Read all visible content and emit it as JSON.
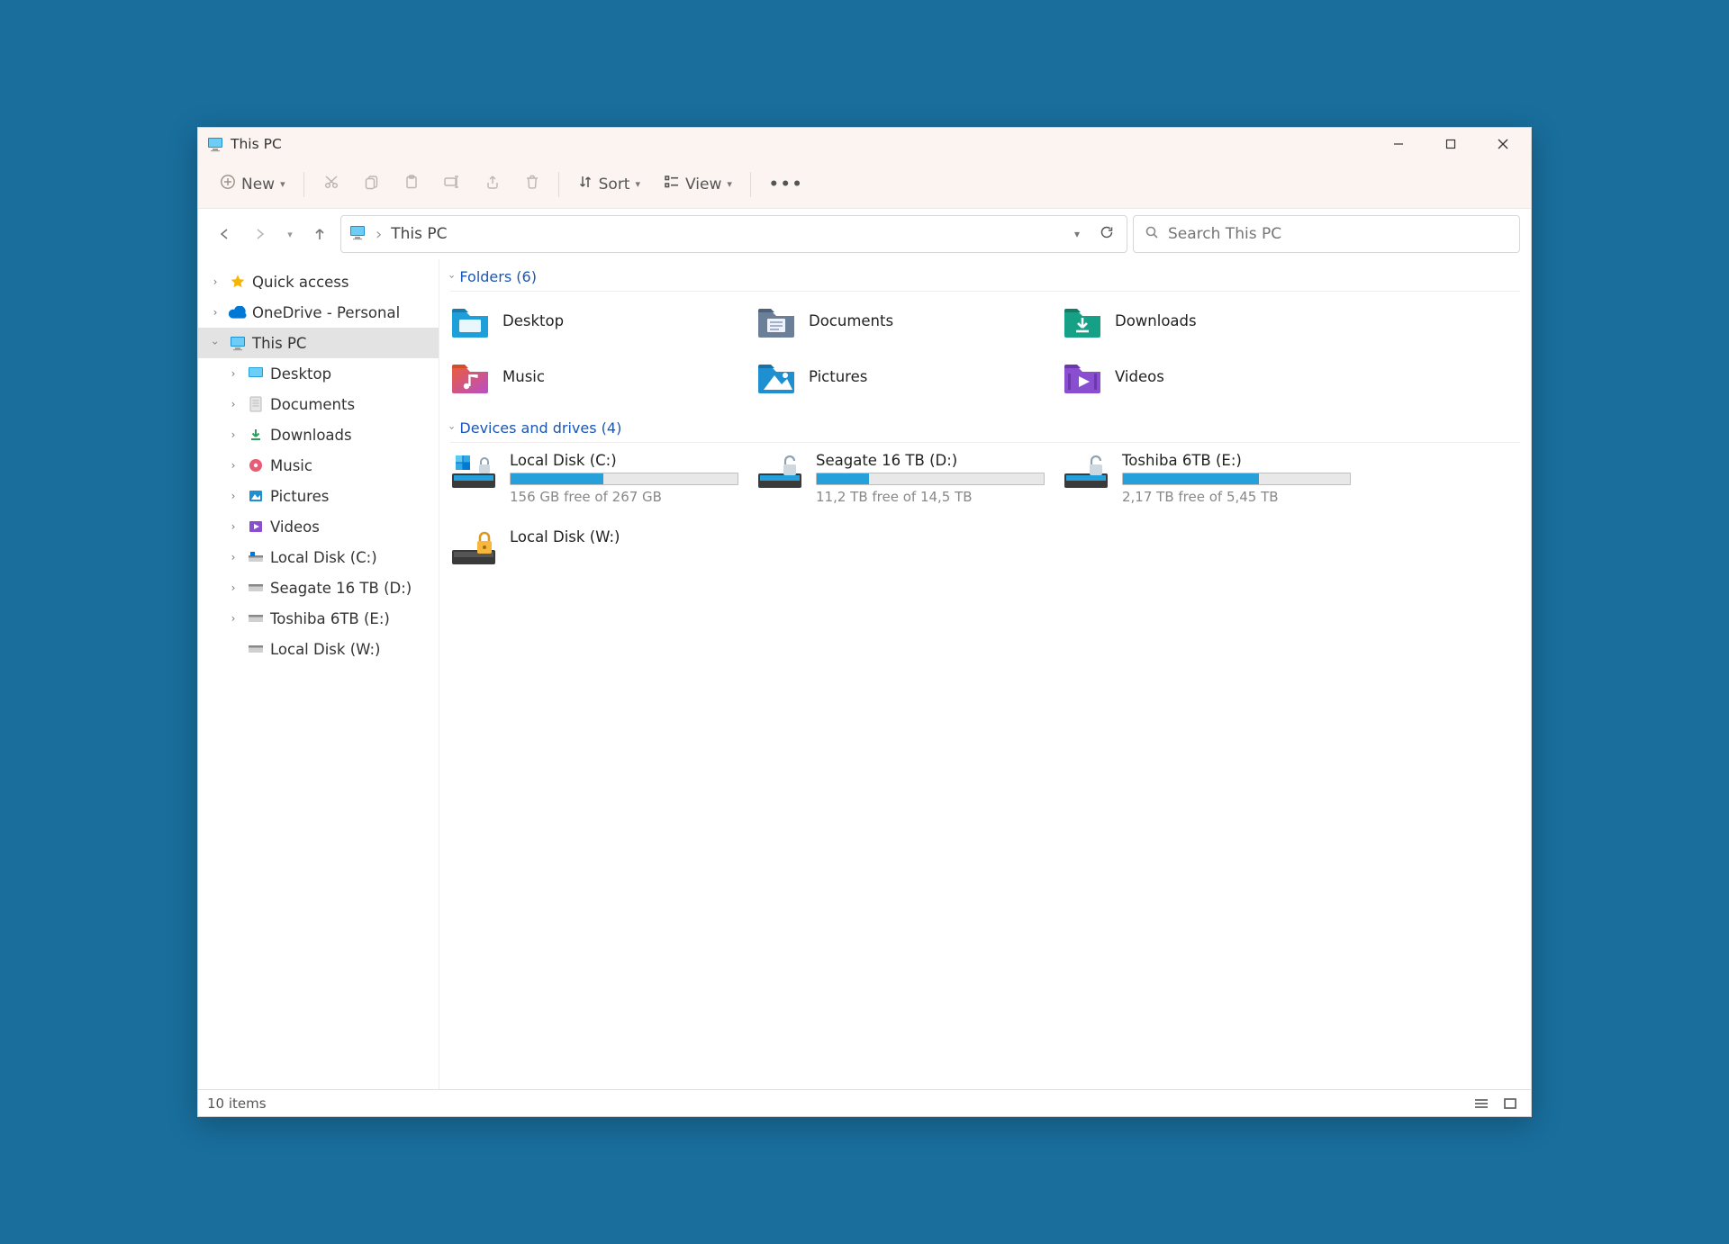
{
  "window": {
    "title": "This PC"
  },
  "toolbar": {
    "new_label": "New",
    "sort_label": "Sort",
    "view_label": "View"
  },
  "address": {
    "location": "This PC"
  },
  "search": {
    "placeholder": "Search This PC"
  },
  "sidebar": {
    "quick_access": "Quick access",
    "onedrive": "OneDrive - Personal",
    "this_pc": "This PC",
    "children": [
      {
        "label": "Desktop"
      },
      {
        "label": "Documents"
      },
      {
        "label": "Downloads"
      },
      {
        "label": "Music"
      },
      {
        "label": "Pictures"
      },
      {
        "label": "Videos"
      },
      {
        "label": "Local Disk (C:)"
      },
      {
        "label": "Seagate 16 TB (D:)"
      },
      {
        "label": "Toshiba 6TB (E:)"
      },
      {
        "label": "Local Disk (W:)"
      }
    ]
  },
  "groups": {
    "folders": {
      "header": "Folders (6)",
      "items": [
        {
          "label": "Desktop"
        },
        {
          "label": "Documents"
        },
        {
          "label": "Downloads"
        },
        {
          "label": "Music"
        },
        {
          "label": "Pictures"
        },
        {
          "label": "Videos"
        }
      ]
    },
    "drives": {
      "header": "Devices and drives (4)",
      "items": [
        {
          "label": "Local Disk (C:)",
          "free_text": "156 GB free of 267 GB",
          "fill_pct": 41
        },
        {
          "label": "Seagate 16 TB (D:)",
          "free_text": "11,2 TB free of 14,5 TB",
          "fill_pct": 23
        },
        {
          "label": "Toshiba 6TB (E:)",
          "free_text": "2,17 TB free of 5,45 TB",
          "fill_pct": 60
        },
        {
          "label": "Local Disk (W:)",
          "free_text": "",
          "fill_pct": null
        }
      ]
    }
  },
  "statusbar": {
    "items_text": "10 items"
  }
}
